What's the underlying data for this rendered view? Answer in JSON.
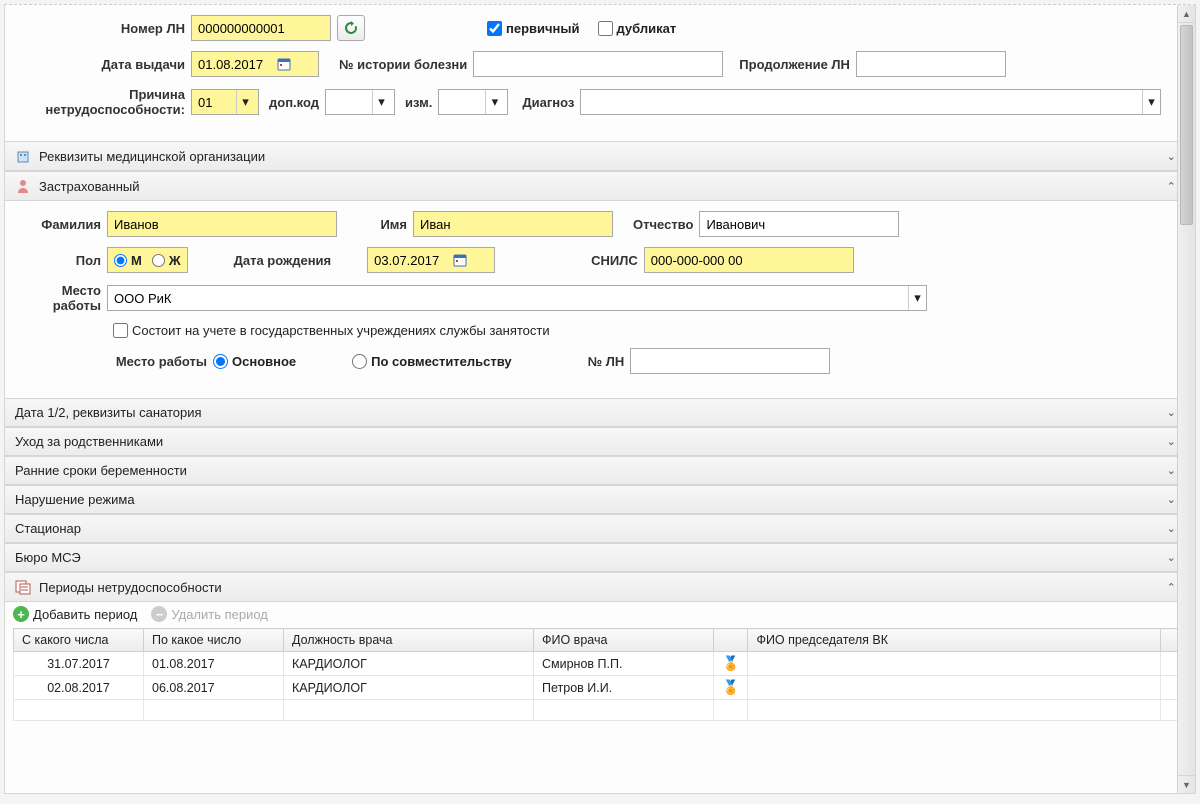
{
  "header": {
    "lbl_number": "Номер ЛН",
    "number": "000000000001",
    "chk_primary": "первичный",
    "chk_duplicate": "дубликат",
    "lbl_issue_date": "Дата выдачи",
    "issue_date": "01.08.2017",
    "lbl_history_no": "№ истории болезни",
    "history_no": "",
    "lbl_continuation": "Продолжение ЛН",
    "continuation": "",
    "lbl_reason_1": "Причина",
    "lbl_reason_2": "нетрудоспособности:",
    "reason": "01",
    "lbl_addcode": "доп.код",
    "addcode": "",
    "lbl_change": "изм.",
    "change": "",
    "lbl_diagnosis": "Диагноз",
    "diagnosis": ""
  },
  "sections": {
    "org": "Реквизиты медицинской организации",
    "insured": "Застрахованный",
    "date12": "Дата 1/2, реквизиты санатория",
    "care": "Уход за родственниками",
    "pregnancy": "Ранние сроки беременности",
    "violation": "Нарушение режима",
    "hospital": "Стационар",
    "mse": "Бюро МСЭ",
    "periods": "Периоды нетрудоспособности"
  },
  "insured": {
    "lbl_lastname": "Фамилия",
    "lastname": "Иванов",
    "lbl_firstname": "Имя",
    "firstname": "Иван",
    "lbl_patronymic": "Отчество",
    "patronymic": "Иванович",
    "lbl_gender": "Пол",
    "gender_m": "М",
    "gender_f": "Ж",
    "lbl_birthdate": "Дата рождения",
    "birthdate": "03.07.2017",
    "lbl_snils": "СНИЛС",
    "snils": "000-000-000 00",
    "lbl_workplace": "Место",
    "lbl_workplace2": "работы",
    "workplace": "ООО РиК",
    "chk_employment_center": "Состоит на учете в государственных учреждениях службы занятости",
    "lbl_workplace_type": "Место работы",
    "radio_main": "Основное",
    "radio_secondary": "По совместительству",
    "lbl_ln_no": "№ ЛН",
    "ln_no": ""
  },
  "periods": {
    "add": "Добавить период",
    "del": "Удалить период",
    "cols": {
      "from": "С какого числа",
      "to": "По какое число",
      "position": "Должность врача",
      "doctor": "ФИО врача",
      "chairman": "ФИО председателя ВК"
    },
    "rows": [
      {
        "from": "31.07.2017",
        "to": "01.08.2017",
        "position": "КАРДИОЛОГ",
        "doctor": "Смирнов П.П.",
        "chairman": ""
      },
      {
        "from": "02.08.2017",
        "to": "06.08.2017",
        "position": "КАРДИОЛОГ",
        "doctor": "Петров И.И.",
        "chairman": ""
      }
    ]
  }
}
